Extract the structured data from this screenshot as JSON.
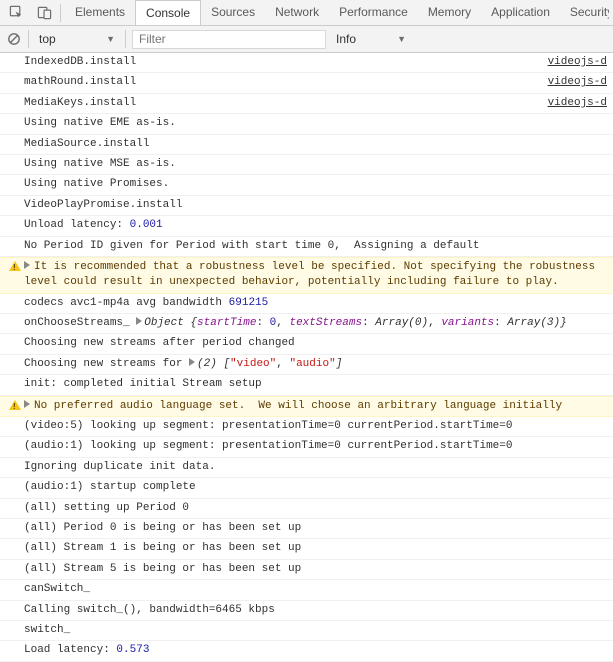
{
  "tabs": [
    "Elements",
    "Console",
    "Sources",
    "Network",
    "Performance",
    "Memory",
    "Application",
    "Security"
  ],
  "activeTab": "Console",
  "filterbar": {
    "context": "top",
    "filterPlaceholder": "Filter",
    "level": "Info"
  },
  "rows": [
    {
      "type": "log",
      "text": "IndexedDB.install",
      "src": "videojs-d"
    },
    {
      "type": "log",
      "text": "mathRound.install",
      "src": "videojs-d"
    },
    {
      "type": "log",
      "text": "MediaKeys.install",
      "src": "videojs-d"
    },
    {
      "type": "log",
      "text": "Using native EME as-is."
    },
    {
      "type": "log",
      "text": "MediaSource.install"
    },
    {
      "type": "log",
      "text": "Using native MSE as-is."
    },
    {
      "type": "log",
      "text": "Using native Promises."
    },
    {
      "type": "log",
      "text": "VideoPlayPromise.install"
    },
    {
      "type": "log",
      "parts": [
        {
          "t": "Unload latency: "
        },
        {
          "t": "0.001",
          "cls": "num"
        }
      ]
    },
    {
      "type": "log",
      "text": "No Period ID given for Period with start time 0,  Assigning a default"
    },
    {
      "type": "warn",
      "expand": true,
      "text": "It is recommended that a robustness level be specified. Not specifying the robustness level could result in unexpected behavior, potentially including failure to play."
    },
    {
      "type": "log",
      "parts": [
        {
          "t": "codecs avc1-mp4a avg bandwidth "
        },
        {
          "t": "691215",
          "cls": "num"
        }
      ]
    },
    {
      "type": "log",
      "parts": [
        {
          "t": "onChooseStreams_ "
        },
        {
          "t": "▶",
          "cls": "tri-inline"
        },
        {
          "t": "Object {",
          "cls": "objlit"
        },
        {
          "t": "startTime",
          "cls": "objkey"
        },
        {
          "t": ": "
        },
        {
          "t": "0",
          "cls": "num"
        },
        {
          "t": ", "
        },
        {
          "t": "textStreams",
          "cls": "objkey"
        },
        {
          "t": ": "
        },
        {
          "t": "Array(0)",
          "cls": "objlit"
        },
        {
          "t": ", "
        },
        {
          "t": "variants",
          "cls": "objkey"
        },
        {
          "t": ": "
        },
        {
          "t": "Array(3)",
          "cls": "objlit"
        },
        {
          "t": "}",
          "cls": "objlit"
        }
      ]
    },
    {
      "type": "log",
      "text": "Choosing new streams after period changed"
    },
    {
      "type": "log",
      "parts": [
        {
          "t": "Choosing new streams for "
        },
        {
          "t": "▶",
          "cls": "tri-inline"
        },
        {
          "t": "(2) ",
          "cls": "objlit"
        },
        {
          "t": "[",
          "cls": "objlit"
        },
        {
          "t": "\"video\"",
          "cls": "str"
        },
        {
          "t": ", "
        },
        {
          "t": "\"audio\"",
          "cls": "str"
        },
        {
          "t": "]",
          "cls": "objlit"
        }
      ]
    },
    {
      "type": "log",
      "text": "init: completed initial Stream setup"
    },
    {
      "type": "warn",
      "expand": true,
      "text": "No preferred audio language set.  We will choose an arbitrary language initially"
    },
    {
      "type": "log",
      "text": "(video:5) looking up segment: presentationTime=0 currentPeriod.startTime=0"
    },
    {
      "type": "log",
      "text": "(audio:1) looking up segment: presentationTime=0 currentPeriod.startTime=0"
    },
    {
      "type": "log",
      "text": "Ignoring duplicate init data."
    },
    {
      "type": "log",
      "text": "(audio:1) startup complete"
    },
    {
      "type": "log",
      "text": "(all) setting up Period 0"
    },
    {
      "type": "log",
      "text": "(all) Period 0 is being or has been set up"
    },
    {
      "type": "log",
      "text": "(all) Stream 1 is being or has been set up"
    },
    {
      "type": "log",
      "text": "(all) Stream 5 is being or has been set up"
    },
    {
      "type": "log",
      "text": "canSwitch_"
    },
    {
      "type": "log",
      "text": "Calling switch_(), bandwidth=6465 kbps"
    },
    {
      "type": "log",
      "text": "switch_"
    },
    {
      "type": "log",
      "parts": [
        {
          "t": "Load latency: "
        },
        {
          "t": "0.573",
          "cls": "num"
        }
      ]
    }
  ]
}
